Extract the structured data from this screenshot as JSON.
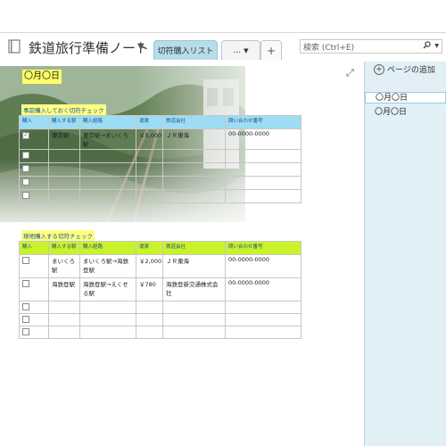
{
  "notebook": {
    "title": "鉄道旅行準備ノート",
    "chevron": "▼"
  },
  "tabs": [
    {
      "label": "切符購入リスト",
      "active": true
    },
    {
      "label": "...",
      "dropdown": "▼"
    },
    {
      "label": "+"
    }
  ],
  "search": {
    "placeholder": "検索 (Ctrl+E)",
    "icon": "search-icon"
  },
  "page": {
    "date": "〇月〇日",
    "section1": {
      "label": "事前購入しておく切符チェック",
      "headers": [
        "購入",
        "購入する駅",
        "購入経路",
        "運賃",
        "鉄道会社",
        "問い合わせ番号"
      ],
      "rows": [
        {
          "checked": true,
          "station": "東京駅",
          "route": "東京駅→まいくろ駅",
          "fare": "￥5,000",
          "company": "ＪＲ東海",
          "phone": "00-0000-0000"
        },
        {
          "checked": false,
          "station": "",
          "route": "",
          "fare": "",
          "company": "",
          "phone": ""
        },
        {
          "checked": false,
          "station": "",
          "route": "",
          "fare": "",
          "company": "",
          "phone": ""
        },
        {
          "checked": false,
          "station": "",
          "route": "",
          "fare": "",
          "company": "",
          "phone": ""
        },
        {
          "checked": false,
          "station": "",
          "route": "",
          "fare": "",
          "company": "",
          "phone": ""
        }
      ]
    },
    "section2": {
      "label": "現地購入する切符チェック",
      "headers": [
        "購入",
        "購入する駅",
        "購入経路",
        "運賃",
        "鉄道会社",
        "問い合わせ番号"
      ],
      "rows": [
        {
          "checked": false,
          "station": "まいくろ駅",
          "route": "まいくろ駅→海鉄登駅",
          "fare": "￥2,000",
          "company": "ＪＲ東海",
          "phone": "00-0000-0000"
        },
        {
          "checked": false,
          "station": "海鉄登駅",
          "route": "海鉄登駅→えくせる駅",
          "fare": "￥780",
          "company": "海鉄登新交通株式会社",
          "phone": "00-0000-0000"
        },
        {
          "checked": false,
          "station": "",
          "route": "",
          "fare": "",
          "company": "",
          "phone": ""
        },
        {
          "checked": false,
          "station": "",
          "route": "",
          "fare": "",
          "company": "",
          "phone": ""
        },
        {
          "checked": false,
          "station": "",
          "route": "",
          "fare": "",
          "company": "",
          "phone": ""
        }
      ]
    }
  },
  "panel": {
    "add_page": "ページの追加",
    "pages": [
      "〇月〇日",
      "〇月〇日"
    ]
  },
  "colors": {
    "tab_active": "#b6dde8",
    "table1_header": "#9ddcf3",
    "table2_header": "#c9f22c",
    "label_highlight": "#ffff80",
    "panel_bg": "#e1f0f6"
  }
}
